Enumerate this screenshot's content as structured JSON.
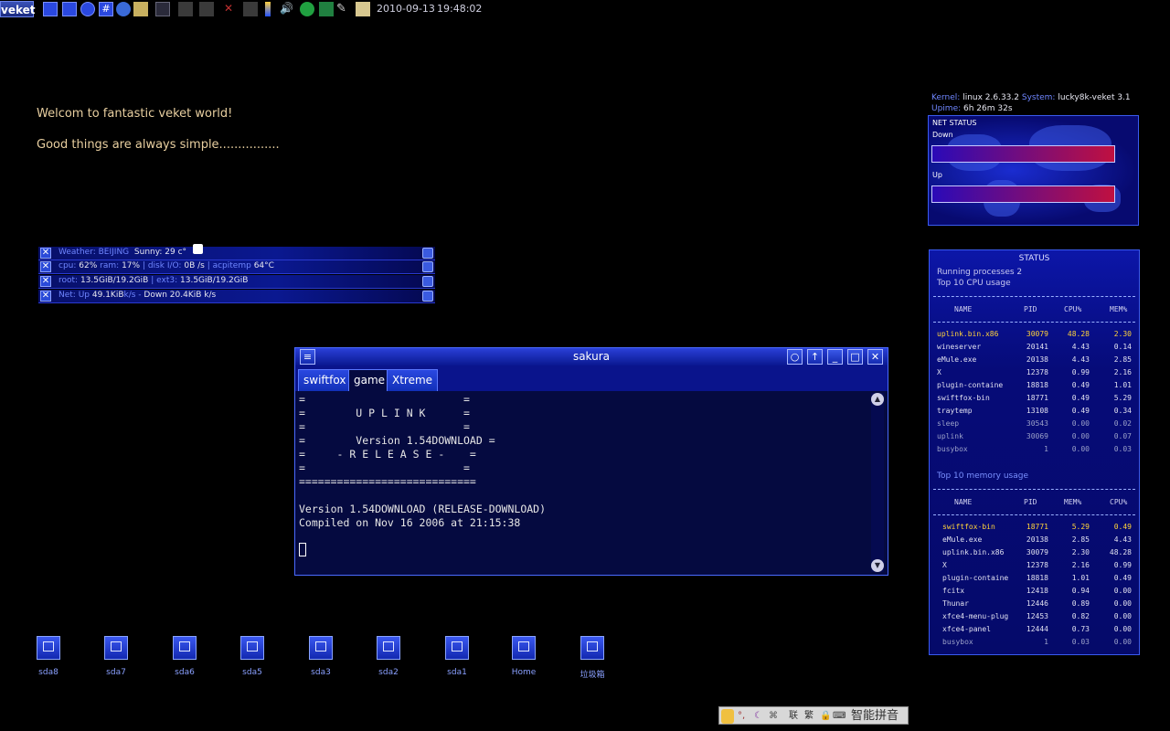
{
  "top_panel": {
    "menu_label": "veket",
    "date": "2010-09-13",
    "time": "19:48:02"
  },
  "welcome": {
    "line1": "Welcom to fantastic veket world!",
    "line2": "Good things are always simple................"
  },
  "conky": {
    "weather_label": "Weather: BEIJING",
    "weather_value": "Sunny: 29 c°",
    "cpu_label": "cpu:",
    "cpu_value": "62%",
    "ram_label": "ram:",
    "ram_value": "17%",
    "disk_label": "| disk I/O:",
    "disk_value": "0B /s",
    "acpitemp_label": "| acpitemp",
    "acpitemp_value": "64°C",
    "root_label": "root:",
    "root_value": "13.5GiB/19.2GiB",
    "ext3_label": "| ext3:",
    "ext3_value": "13.5GiB/19.2GiB",
    "net_label": "Net: Up",
    "net_up": "49.1KiB",
    "net_ks": "k/s -",
    "net_down": "Down 20.4KiB k/s"
  },
  "sysinfo": {
    "kernel_label": "Kernel:",
    "kernel_value": "linux 2.6.33.2",
    "system_label": "System:",
    "system_value": "lucky8k-veket 3.1",
    "uptime_label": "Upime:",
    "uptime_value": "6h 26m 32s"
  },
  "net_status": {
    "title": "NET STATUS",
    "down_label": "Down",
    "up_label": "Up"
  },
  "status": {
    "title": "STATUS",
    "running": "Running processes 2",
    "top_cpu_title": "Top 10 CPU usage",
    "top_mem_title": "Top 10 memory usage",
    "cpu_headers": [
      "NAME",
      "PID",
      "CPU%",
      "MEM%"
    ],
    "mem_headers": [
      "NAME",
      "PID",
      "MEM%",
      "CPU%"
    ],
    "cpu_rows": [
      [
        "uplink.bin.x86",
        "30079",
        "48.28",
        "2.30"
      ],
      [
        "wineserver",
        "20141",
        "4.43",
        "0.14"
      ],
      [
        "eMule.exe",
        "20138",
        "4.43",
        "2.85"
      ],
      [
        "X",
        "12378",
        "0.99",
        "2.16"
      ],
      [
        "plugin-containe",
        "18818",
        "0.49",
        "1.01"
      ],
      [
        "swiftfox-bin",
        "18771",
        "0.49",
        "5.29"
      ],
      [
        "traytemp",
        "13108",
        "0.49",
        "0.34"
      ],
      [
        "sleep",
        "30543",
        "0.00",
        "0.02"
      ],
      [
        "uplink",
        "30069",
        "0.00",
        "0.07"
      ],
      [
        "busybox",
        "1",
        "0.00",
        "0.03"
      ]
    ],
    "mem_rows": [
      [
        "swiftfox-bin",
        "18771",
        "5.29",
        "0.49"
      ],
      [
        "eMule.exe",
        "20138",
        "2.85",
        "4.43"
      ],
      [
        "uplink.bin.x86",
        "30079",
        "2.30",
        "48.28"
      ],
      [
        "X",
        "12378",
        "2.16",
        "0.99"
      ],
      [
        "plugin-containe",
        "18818",
        "1.01",
        "0.49"
      ],
      [
        "fcitx",
        "12418",
        "0.94",
        "0.00"
      ],
      [
        "Thunar",
        "12446",
        "0.89",
        "0.00"
      ],
      [
        "xfce4-menu-plug",
        "12453",
        "0.82",
        "0.00"
      ],
      [
        "xfce4-panel",
        "12444",
        "0.73",
        "0.00"
      ],
      [
        "busybox",
        "1",
        "0.03",
        "0.00"
      ]
    ]
  },
  "terminal": {
    "title": "sakura",
    "tabs": [
      "swiftfox",
      "game",
      "Xtreme"
    ],
    "active_tab": "game",
    "lines": [
      "=                         =",
      "=        U P L I N K      =",
      "=                         =",
      "=        Version 1.54DOWNLOAD =",
      "=     - R E L E A S E -    =",
      "=                         =",
      "============================",
      "",
      "Version 1.54DOWNLOAD (RELEASE-DOWNLOAD)",
      "Compiled on Nov 16 2006 at 21:15:38"
    ]
  },
  "desktop_icons": [
    "sda8",
    "sda7",
    "sda6",
    "sda5",
    "sda3",
    "sda2",
    "sda1",
    "Home",
    "垃圾箱"
  ],
  "ime": {
    "trad_label": "联",
    "trad2_label": "繁",
    "name": "智能拼音"
  }
}
